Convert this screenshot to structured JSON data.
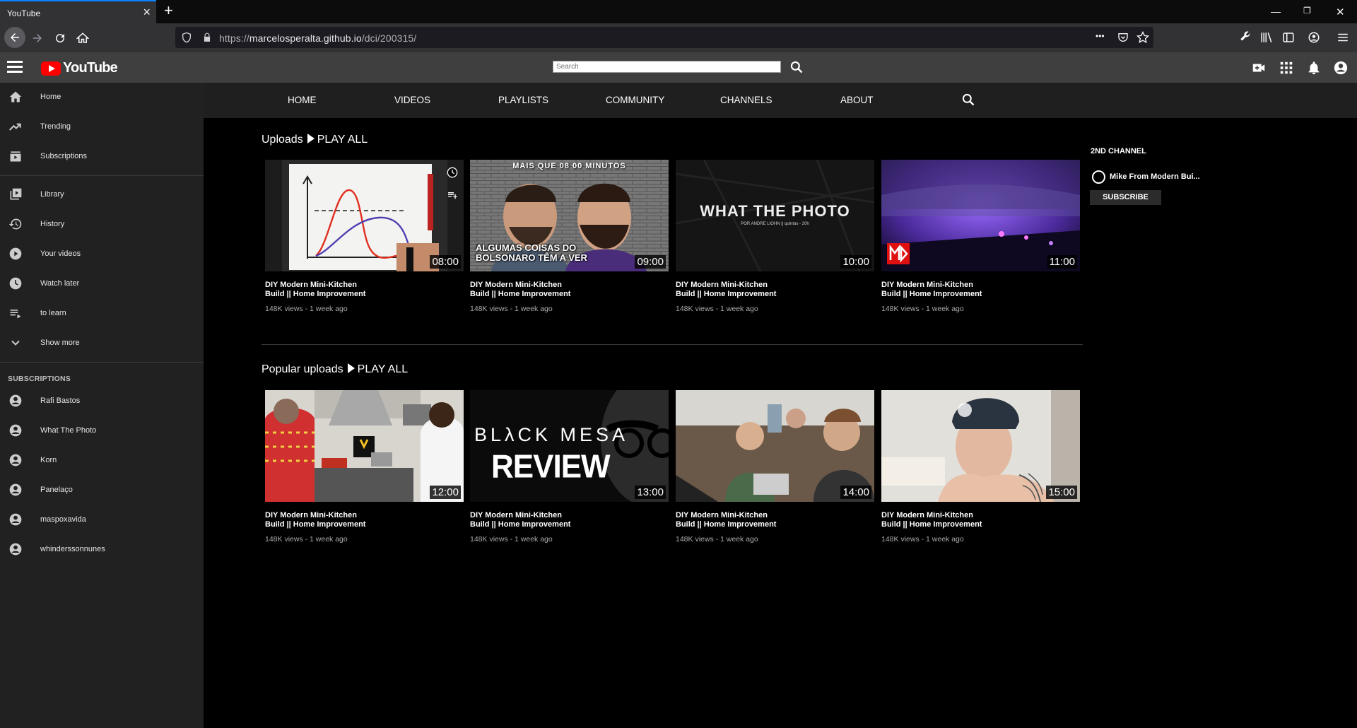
{
  "browser": {
    "tab_title": "YouTube",
    "tab_close": "×",
    "new_tab": "+",
    "url_prefix": "https://",
    "url_host": "marcelosperalta.github.io",
    "url_path": "/dci/200315/",
    "url_more": "•••"
  },
  "header": {
    "logo_text": "YouTube",
    "search_placeholder": "Search"
  },
  "sidebar": {
    "items": [
      {
        "label": "Home",
        "icon": "home-icon"
      },
      {
        "label": "Trending",
        "icon": "trending-icon"
      },
      {
        "label": "Subscriptions",
        "icon": "subscriptions-icon"
      },
      {
        "label": "Library",
        "icon": "library-icon"
      },
      {
        "label": "History",
        "icon": "history-icon"
      },
      {
        "label": "Your videos",
        "icon": "your-videos-icon"
      },
      {
        "label": "Watch later",
        "icon": "watch-later-icon"
      },
      {
        "label": "to learn",
        "icon": "playlist-icon"
      },
      {
        "label": "Show more",
        "icon": "chevron-down-icon"
      }
    ],
    "subscriptions_heading": "SUBSCRIPTIONS",
    "subscriptions": [
      {
        "label": "Rafi Bastos"
      },
      {
        "label": "What The Photo"
      },
      {
        "label": "Korn"
      },
      {
        "label": "Panelaço"
      },
      {
        "label": "maspoxavida"
      },
      {
        "label": "whinderssonnunes"
      }
    ]
  },
  "channel_nav": {
    "tabs": [
      "HOME",
      "VIDEOS",
      "PLAYLISTS",
      "COMMUNITY",
      "CHANNELS",
      "ABOUT"
    ]
  },
  "sections": {
    "uploads": {
      "title": "Uploads",
      "play_all": "PLAY ALL",
      "videos": [
        {
          "duration": "08:00",
          "title": "DIY Modern Mini-Kitchen Build || Home Improvement",
          "meta": "148K views - 1 week ago"
        },
        {
          "duration": "09:00",
          "title": "DIY Modern Mini-Kitchen Build || Home Improvement",
          "meta": "148K views - 1 week ago",
          "overlay_top": "MAIS QUE 08 00 MINUTOS",
          "overlay_bottom": "ALGUMAS COISAS DO BOLSONARO TÊM A VER"
        },
        {
          "duration": "10:00",
          "title": "DIY Modern Mini-Kitchen Build || Home Improvement",
          "meta": "148K views - 1 week ago",
          "overlay_main": "WHAT THE PHOTO",
          "overlay_sub": "POR ANDRE LIOHN || quintas - 20h"
        },
        {
          "duration": "11:00",
          "title": "DIY Modern Mini-Kitchen Build || Home Improvement",
          "meta": "148K views - 1 week ago"
        }
      ]
    },
    "popular": {
      "title": "Popular uploads",
      "play_all": "PLAY ALL",
      "videos": [
        {
          "duration": "12:00",
          "title": "DIY Modern Mini-Kitchen Build || Home Improvement",
          "meta": "148K views - 1 week ago"
        },
        {
          "duration": "13:00",
          "title": "DIY Modern Mini-Kitchen Build || Home Improvement",
          "meta": "148K views - 1 week ago",
          "overlay_main": "BLλCK MESA",
          "overlay_sub": "REVIEW"
        },
        {
          "duration": "14:00",
          "title": "DIY Modern Mini-Kitchen Build || Home Improvement",
          "meta": "148K views - 1 week ago"
        },
        {
          "duration": "15:00",
          "title": "DIY Modern Mini-Kitchen Build || Home Improvement",
          "meta": "148K views - 1 week ago"
        }
      ]
    }
  },
  "right_column": {
    "heading": "2ND CHANNEL",
    "channel_name": "Mike From Modern Bui...",
    "subscribe_label": "SUBSCRIBE"
  },
  "colors": {
    "accent": "#ff0000",
    "header_bg": "#3f3f3f",
    "sidebar_bg": "#212121"
  }
}
